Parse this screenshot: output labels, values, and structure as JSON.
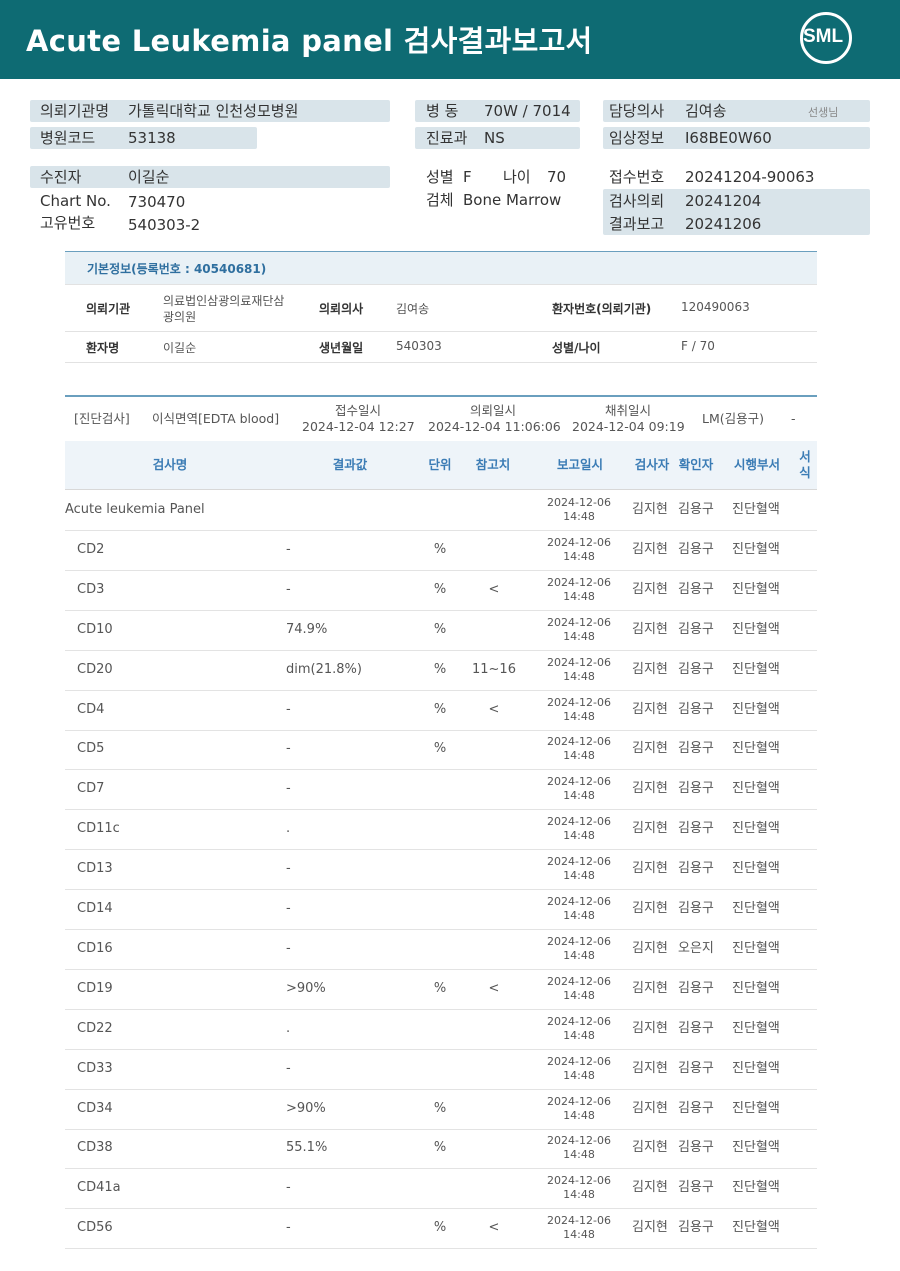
{
  "report": {
    "title": "Acute  Leukemia  panel 검사결과보고서",
    "logo": "SML"
  },
  "patient_header": {
    "institution_label": "의뢰기관명",
    "institution": "가톨릭대학교 인천성모병원",
    "hospital_code_label": "병원코드",
    "hospital_code": "53138",
    "ward_label": "병  동",
    "ward": "70W / 7014",
    "dept_label": "진료과",
    "dept": "NS",
    "doctor_label": "담당의사",
    "doctor": "김여송",
    "doctor_suffix": "선생님",
    "clinical_info_label": "임상정보",
    "clinical_info": "I68BE0W60",
    "examinee_label": "수진자",
    "examinee": "이길순",
    "chart_no_label": "Chart No.",
    "chart_no": "730470",
    "unique_no_label": "고유번호",
    "unique_no": "540303-2",
    "sex_label": "성별",
    "sex": "F",
    "age_label": "나이",
    "age": "70",
    "specimen_label": "검체",
    "specimen": "Bone Marrow",
    "receipt_no_label": "접수번호",
    "receipt_no": "20241204-90063",
    "request_label": "검사의뢰",
    "request_date": "20241204",
    "report_label": "결과보고",
    "report_date": "20241206"
  },
  "basic_info": {
    "heading": "기본정보(등록번호 : 40540681)",
    "inst_label": "의뢰기관",
    "inst_line1": "의료법인삼광의료재단삼",
    "inst_line2": "광의원",
    "req_doctor_label": "의뢰의사",
    "req_doctor": "김여송",
    "patient_no_label": "환자번호(의뢰기관)",
    "patient_no": "120490063",
    "patient_name_label": "환자명",
    "patient_name": "이길순",
    "birth_label": "생년월일",
    "birth": "540303",
    "sex_age_label": "성별/나이",
    "sex_age": "F / 70"
  },
  "test_info": {
    "category": "[진단검사]",
    "test_name": "이식면역[EDTA blood]",
    "receipt_label": "접수일시",
    "receipt_dt": "2024-12-04 12:27",
    "request_label": "의뢰일시",
    "request_dt": "2024-12-04 11:06:06",
    "collect_label": "채취일시",
    "collect_dt": "2024-12-04 09:19",
    "lm": "LM(김용구)",
    "dash": "-"
  },
  "table": {
    "headers": {
      "name": "검사명",
      "result": "결과값",
      "unit": "단위",
      "ref": "참고치",
      "report_dt": "보고일시",
      "tester": "검사자",
      "confirmer": "확인자",
      "dept": "시행부서",
      "form": "서식"
    },
    "rows": [
      {
        "name": "Acute leukemia Panel",
        "result": "",
        "unit": "",
        "ref": "",
        "date": "2024-12-06",
        "time": "14:48",
        "tester": "김지현",
        "confirmer": "김용구",
        "dept": "진단혈액"
      },
      {
        "name": "CD2",
        "result": "-",
        "unit": "%",
        "ref": "",
        "date": "2024-12-06",
        "time": "14:48",
        "tester": "김지현",
        "confirmer": "김용구",
        "dept": "진단혈액"
      },
      {
        "name": "CD3",
        "result": "-",
        "unit": "%",
        "ref": "<",
        "date": "2024-12-06",
        "time": "14:48",
        "tester": "김지현",
        "confirmer": "김용구",
        "dept": "진단혈액"
      },
      {
        "name": "CD10",
        "result": "74.9%",
        "unit": "%",
        "ref": "",
        "date": "2024-12-06",
        "time": "14:48",
        "tester": "김지현",
        "confirmer": "김용구",
        "dept": "진단혈액"
      },
      {
        "name": "CD20",
        "result": "dim(21.8%)",
        "unit": "%",
        "ref": "11~16",
        "date": "2024-12-06",
        "time": "14:48",
        "tester": "김지현",
        "confirmer": "김용구",
        "dept": "진단혈액"
      },
      {
        "name": "CD4",
        "result": "-",
        "unit": "%",
        "ref": "<",
        "date": "2024-12-06",
        "time": "14:48",
        "tester": "김지현",
        "confirmer": "김용구",
        "dept": "진단혈액"
      },
      {
        "name": "CD5",
        "result": "-",
        "unit": "%",
        "ref": "",
        "date": "2024-12-06",
        "time": "14:48",
        "tester": "김지현",
        "confirmer": "김용구",
        "dept": "진단혈액"
      },
      {
        "name": "CD7",
        "result": "-",
        "unit": "",
        "ref": "",
        "date": "2024-12-06",
        "time": "14:48",
        "tester": "김지현",
        "confirmer": "김용구",
        "dept": "진단혈액"
      },
      {
        "name": "CD11c",
        "result": ".",
        "unit": "",
        "ref": "",
        "date": "2024-12-06",
        "time": "14:48",
        "tester": "김지현",
        "confirmer": "김용구",
        "dept": "진단혈액"
      },
      {
        "name": "CD13",
        "result": "-",
        "unit": "",
        "ref": "",
        "date": "2024-12-06",
        "time": "14:48",
        "tester": "김지현",
        "confirmer": "김용구",
        "dept": "진단혈액"
      },
      {
        "name": "CD14",
        "result": "-",
        "unit": "",
        "ref": "",
        "date": "2024-12-06",
        "time": "14:48",
        "tester": "김지현",
        "confirmer": "김용구",
        "dept": "진단혈액"
      },
      {
        "name": "CD16",
        "result": "-",
        "unit": "",
        "ref": "",
        "date": "2024-12-06",
        "time": "14:48",
        "tester": "김지현",
        "confirmer": "오은지",
        "dept": "진단혈액"
      },
      {
        "name": "CD19",
        "result": ">90%",
        "unit": "%",
        "ref": "<",
        "date": "2024-12-06",
        "time": "14:48",
        "tester": "김지현",
        "confirmer": "김용구",
        "dept": "진단혈액"
      },
      {
        "name": "CD22",
        "result": ".",
        "unit": "",
        "ref": "",
        "date": "2024-12-06",
        "time": "14:48",
        "tester": "김지현",
        "confirmer": "김용구",
        "dept": "진단혈액"
      },
      {
        "name": "CD33",
        "result": "-",
        "unit": "",
        "ref": "",
        "date": "2024-12-06",
        "time": "14:48",
        "tester": "김지현",
        "confirmer": "김용구",
        "dept": "진단혈액"
      },
      {
        "name": "CD34",
        "result": ">90%",
        "unit": "%",
        "ref": "",
        "date": "2024-12-06",
        "time": "14:48",
        "tester": "김지현",
        "confirmer": "김용구",
        "dept": "진단혈액"
      },
      {
        "name": "CD38",
        "result": "55.1%",
        "unit": "%",
        "ref": "",
        "date": "2024-12-06",
        "time": "14:48",
        "tester": "김지현",
        "confirmer": "김용구",
        "dept": "진단혈액"
      },
      {
        "name": "CD41a",
        "result": "-",
        "unit": "",
        "ref": "",
        "date": "2024-12-06",
        "time": "14:48",
        "tester": "김지현",
        "confirmer": "김용구",
        "dept": "진단혈액"
      },
      {
        "name": "CD56",
        "result": "-",
        "unit": "%",
        "ref": "<",
        "date": "2024-12-06",
        "time": "14:48",
        "tester": "김지현",
        "confirmer": "김용구",
        "dept": "진단혈액"
      }
    ]
  }
}
